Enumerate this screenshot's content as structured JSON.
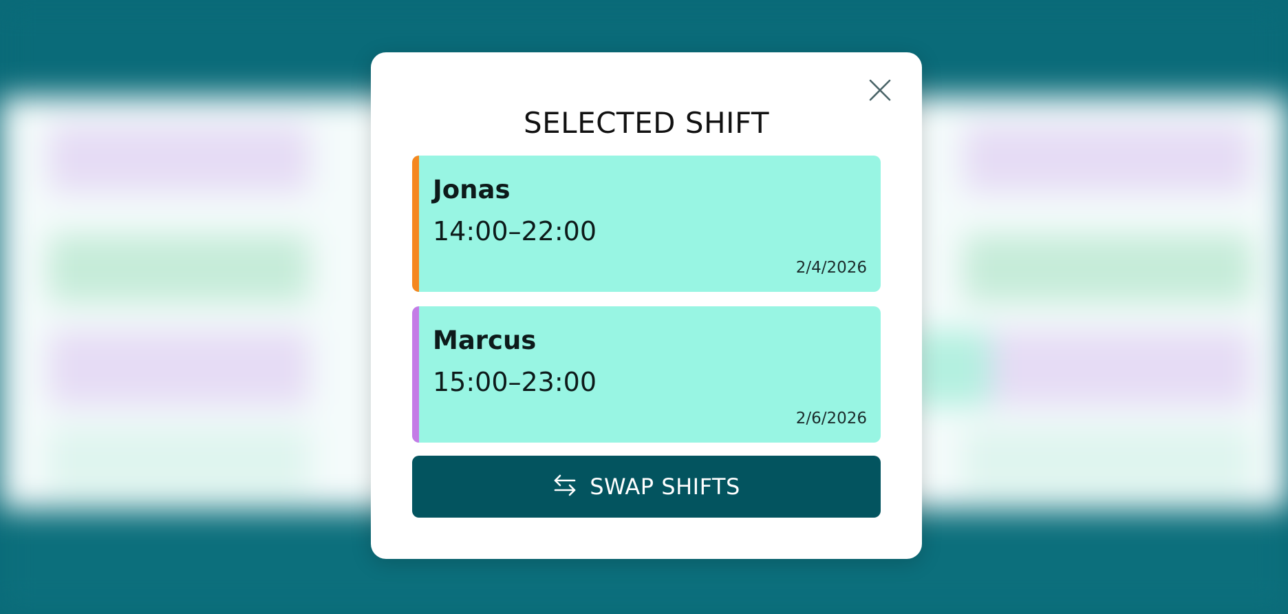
{
  "modal": {
    "title": "SELECTED SHIFT",
    "close_icon": "close-icon"
  },
  "shifts": [
    {
      "name": "Jonas",
      "time": "14:00–22:00",
      "date": "2/4/2026",
      "accent": "#f5871f"
    },
    {
      "name": "Marcus",
      "time": "15:00–23:00",
      "date": "2/6/2026",
      "accent": "#c47be6"
    }
  ],
  "swap_button": {
    "label": "SWAP SHIFTS",
    "icon": "swap-arrows-icon"
  },
  "colors": {
    "card_background": "#98f5e3",
    "button_background": "#03545f",
    "backdrop": "#0a6a78"
  }
}
